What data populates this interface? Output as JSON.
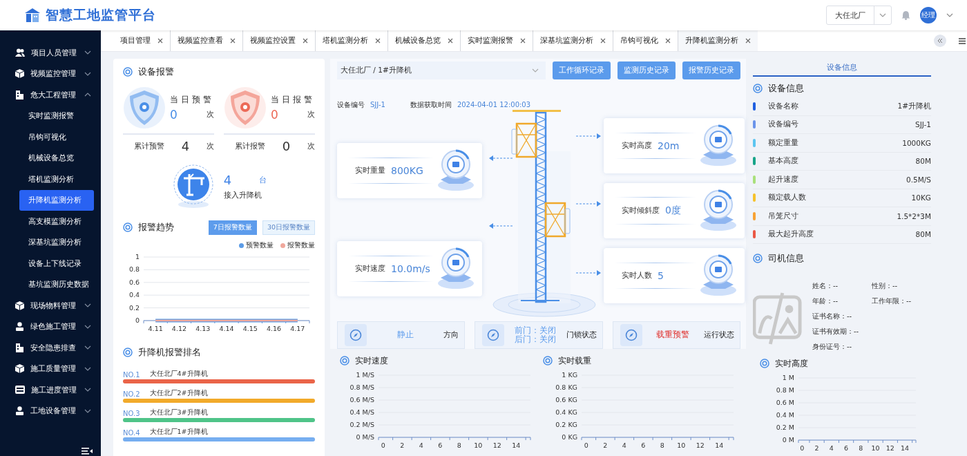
{
  "header": {
    "title": "智慧工地监管平台",
    "site_select": {
      "value": "大任北厂"
    },
    "avatar": "经理"
  },
  "sidebar": {
    "items": [
      {
        "label": "项目人员管理",
        "expanded": false
      },
      {
        "label": "视频监控管理",
        "expanded": false
      },
      {
        "label": "危大工程管理",
        "expanded": true,
        "children": [
          {
            "label": "实时监测报警",
            "selected": false
          },
          {
            "label": "吊钩可视化",
            "selected": false
          },
          {
            "label": "机械设备总览",
            "selected": false
          },
          {
            "label": "塔机监测分析",
            "selected": false
          },
          {
            "label": "升降机监测分析",
            "selected": true
          },
          {
            "label": "高支模监测分析",
            "selected": false
          },
          {
            "label": "深基坑监测分析",
            "selected": false
          },
          {
            "label": "设备上下线记录",
            "selected": false
          },
          {
            "label": "基坑监测历史数据",
            "selected": false
          }
        ]
      },
      {
        "label": "现场物料管理",
        "expanded": false
      },
      {
        "label": "绿色施工管理",
        "expanded": false
      },
      {
        "label": "安全隐患排查",
        "expanded": false
      },
      {
        "label": "施工质量管理",
        "expanded": false
      },
      {
        "label": "施工进度管理",
        "expanded": false
      },
      {
        "label": "工地设备管理",
        "expanded": false
      }
    ]
  },
  "tabs": [
    {
      "label": "项目管理",
      "selected": false
    },
    {
      "label": "视频监控查看",
      "selected": false
    },
    {
      "label": "视频监控设置",
      "selected": false
    },
    {
      "label": "塔机监测分析",
      "selected": false
    },
    {
      "label": "机械设备总览",
      "selected": false
    },
    {
      "label": "实时监测报警",
      "selected": false
    },
    {
      "label": "深基坑监测分析",
      "selected": false
    },
    {
      "label": "吊钩可视化",
      "selected": false
    },
    {
      "label": "升降机监测分析",
      "selected": true
    }
  ],
  "alarm_panel": {
    "title": "设备报警",
    "stats": [
      {
        "today_label": "当日预警",
        "today_value": "0",
        "today_unit": "次",
        "total_label": "累计预警",
        "total_value": "4",
        "total_unit": "次",
        "color": "#4a8fe7"
      },
      {
        "today_label": "当日报警",
        "today_value": "0",
        "today_unit": "次",
        "total_label": "累计报警",
        "total_value": "0",
        "total_unit": "次",
        "color": "#ec6a57"
      }
    ],
    "connected": {
      "value": "4",
      "unit": "台",
      "label": "接入升降机"
    }
  },
  "trend": {
    "title": "报警趋势",
    "buttons": [
      {
        "label": "7日报警数量",
        "selected": true
      },
      {
        "label": "30日报警数量",
        "selected": false
      }
    ],
    "chart_data": {
      "type": "line",
      "grid": true,
      "categories": [
        "4.11",
        "4.12",
        "4.13",
        "4.14",
        "4.15",
        "4.16",
        "4.17"
      ],
      "ylim": [
        0,
        1
      ],
      "yticks": [
        0,
        0.2,
        0.4,
        0.6,
        0.8,
        1
      ],
      "series": [
        {
          "name": "预警数量",
          "color": "#5b9be6",
          "values": [
            0,
            0,
            0,
            0,
            0,
            0,
            0
          ]
        },
        {
          "name": "报警数量",
          "color": "#f0a89c",
          "values": [
            0,
            0,
            0,
            0,
            0,
            0,
            0
          ]
        }
      ]
    }
  },
  "ranking": {
    "title": "升降机报警排名",
    "items": [
      {
        "rank": "NO.1",
        "name": "大任北厂4#升降机",
        "color": "#ea6448",
        "level": 1
      },
      {
        "rank": "NO.2",
        "name": "大任北厂2#升降机",
        "color": "#f2aa2a",
        "level": 1
      },
      {
        "rank": "NO.3",
        "name": "大任北厂3#升降机",
        "color": "#4fc488",
        "level": 1
      },
      {
        "rank": "NO.4",
        "name": "大任北厂1#升降机",
        "color": "#76aef0",
        "level": 1
      }
    ]
  },
  "monitor": {
    "device_select": {
      "value": "大任北厂 / 1#升降机"
    },
    "buttons": [
      "工作循环记录",
      "监测历史记录",
      "报警历史记录"
    ],
    "device_no_label": "设备编号",
    "device_no": "SJJ-1",
    "time_label": "数据获取时间",
    "time": "2024-04-01 12:00:03",
    "left_metrics": [
      {
        "label": "实时重量",
        "value": "800KG"
      },
      {
        "label": "实时速度",
        "value": "10.0m/s"
      }
    ],
    "right_metrics": [
      {
        "label": "实时高度",
        "value": "20m"
      },
      {
        "label": "实时倾斜度",
        "value": "0度"
      },
      {
        "label": "实时人数",
        "value": "5"
      }
    ],
    "statuses": [
      {
        "lines": [
          "静止"
        ],
        "label": "方向",
        "alert": false
      },
      {
        "lines": [
          "前门：关闭",
          "后门：关闭"
        ],
        "label": "门锁状态",
        "alert": false
      },
      {
        "lines": [
          "载重预警"
        ],
        "label": "运行状态",
        "alert": true
      }
    ]
  },
  "realtime_charts": [
    {
      "title": "实时速度",
      "chart_data": {
        "type": "line",
        "grid": true,
        "xlim": [
          -0.5,
          15.5
        ],
        "xticks": [
          0,
          2,
          4,
          6,
          8,
          10,
          12,
          14
        ],
        "ylim": [
          0,
          1
        ],
        "yticks": [
          {
            "value": 0,
            "label": "0 M/S"
          },
          {
            "value": 0.2,
            "label": "0.2 M/S"
          },
          {
            "value": 0.4,
            "label": "0.4 M/S"
          },
          {
            "value": 0.6,
            "label": "0.6 M/S"
          },
          {
            "value": 0.8,
            "label": "0.8 M/S"
          },
          {
            "value": 1,
            "label": "1 M/S"
          }
        ]
      }
    },
    {
      "title": "实时载重",
      "chart_data": {
        "type": "line",
        "grid": true,
        "xlim": [
          -0.5,
          15.5
        ],
        "xticks": [
          0,
          2,
          4,
          6,
          8,
          10,
          12,
          14
        ],
        "ylim": [
          0,
          1
        ],
        "yticks": [
          {
            "value": 0,
            "label": "0 KG"
          },
          {
            "value": 0.2,
            "label": "0.2 KG"
          },
          {
            "value": 0.4,
            "label": "0.4 KG"
          },
          {
            "value": 0.6,
            "label": "0.6 KG"
          },
          {
            "value": 0.8,
            "label": "0.8 KG"
          },
          {
            "value": 1,
            "label": "1 KG"
          }
        ]
      }
    },
    {
      "title": "实时高度",
      "chart_data": {
        "type": "line",
        "grid": true,
        "xlim": [
          -0.5,
          15.5
        ],
        "xticks": [
          0,
          2,
          4,
          6,
          8,
          10,
          12,
          14
        ],
        "ylim": [
          0,
          1
        ],
        "yticks": [
          {
            "value": 0,
            "label": "0 M"
          },
          {
            "value": 0.2,
            "label": "0.2 M"
          },
          {
            "value": 0.4,
            "label": "0.4 M"
          },
          {
            "value": 0.6,
            "label": "0.6 M"
          },
          {
            "value": 0.8,
            "label": "0.8 M"
          },
          {
            "value": 1,
            "label": "1 M"
          }
        ]
      }
    }
  ],
  "device_info": {
    "tab": {
      "label": "设备信息",
      "selected": true
    },
    "title": "设备信息",
    "rows": [
      {
        "label": "设备名称",
        "value": "1#升降机",
        "color": "#1f5fe0"
      },
      {
        "label": "设备编号",
        "value": "SJJ-1",
        "color": "#6b94ea"
      },
      {
        "label": "额定重量",
        "value": "1000KG",
        "color": "#5cc5f0"
      },
      {
        "label": "基本高度",
        "value": "80M",
        "color": "#17a589"
      },
      {
        "label": "起升速度",
        "value": "0.5M/S",
        "color": "#a9e07b"
      },
      {
        "label": "额定载人数",
        "value": "10KG",
        "color": "#f6c22c"
      },
      {
        "label": "吊笼尺寸",
        "value": "1.5*2*3M",
        "color": "#f7a234"
      },
      {
        "label": "最大起升高度",
        "value": "80M",
        "color": "#ea5845"
      }
    ],
    "driver_title": "司机信息",
    "driver_fields": [
      [
        "姓名：--",
        "性别：--"
      ],
      [
        "年龄：--",
        "工作年限：--"
      ],
      [
        "证书名称：--"
      ],
      [
        "证书有效期：--"
      ],
      [
        "身份证号：--"
      ]
    ]
  }
}
